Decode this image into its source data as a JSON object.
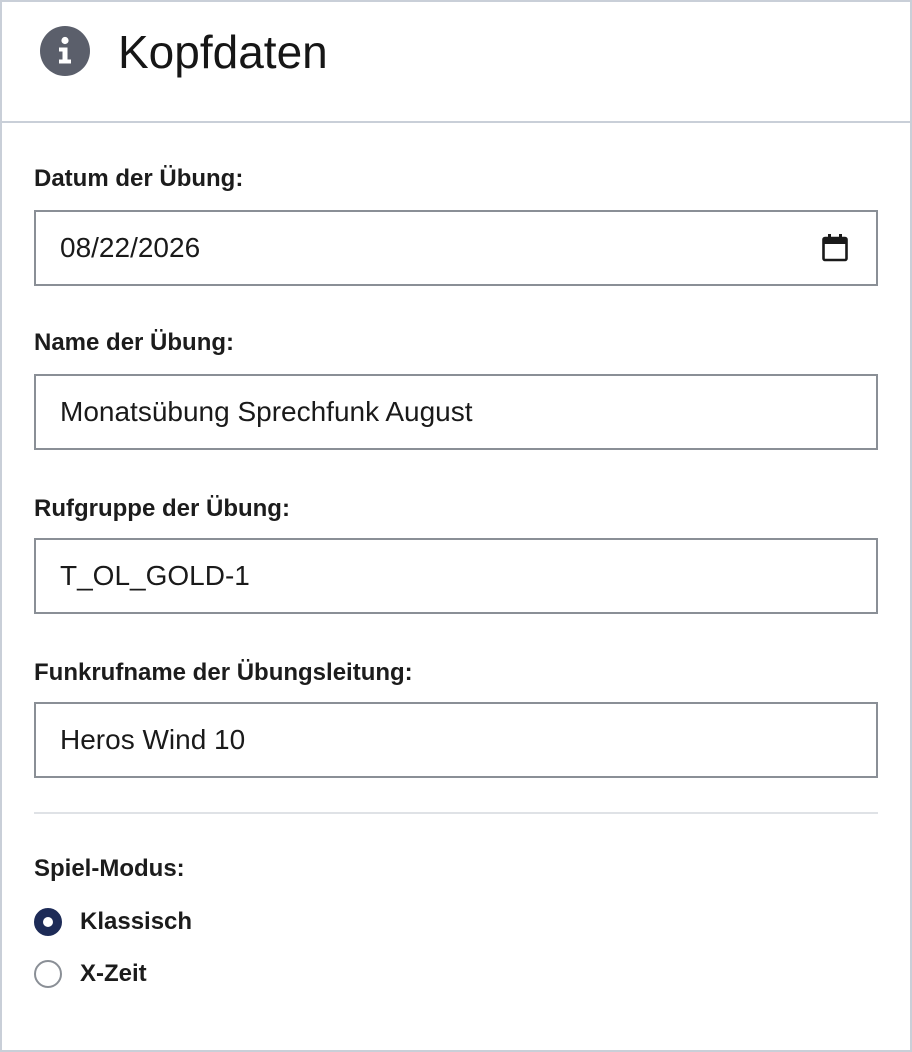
{
  "panel": {
    "title": "Kopfdaten",
    "icon": "info-icon",
    "accent_color": "#5b5f6b"
  },
  "form": {
    "date": {
      "label": "Datum der Übung:",
      "value": "08/22/2026",
      "icon": "calendar-icon"
    },
    "name": {
      "label": "Name der Übung:",
      "value": "Monatsübung Sprechfunk August"
    },
    "call_group": {
      "label": "Rufgruppe der Übung:",
      "value": "T_OL_GOLD-1"
    },
    "leader_callsign": {
      "label": "Funkrufname der Übungsleitung:",
      "value": "Heros Wind 10"
    }
  },
  "game_mode": {
    "label": "Spiel-Modus:",
    "options": [
      {
        "label": "Klassisch",
        "selected": true
      },
      {
        "label": "X-Zeit",
        "selected": false
      }
    ],
    "selected_color": "#1d2b57"
  }
}
